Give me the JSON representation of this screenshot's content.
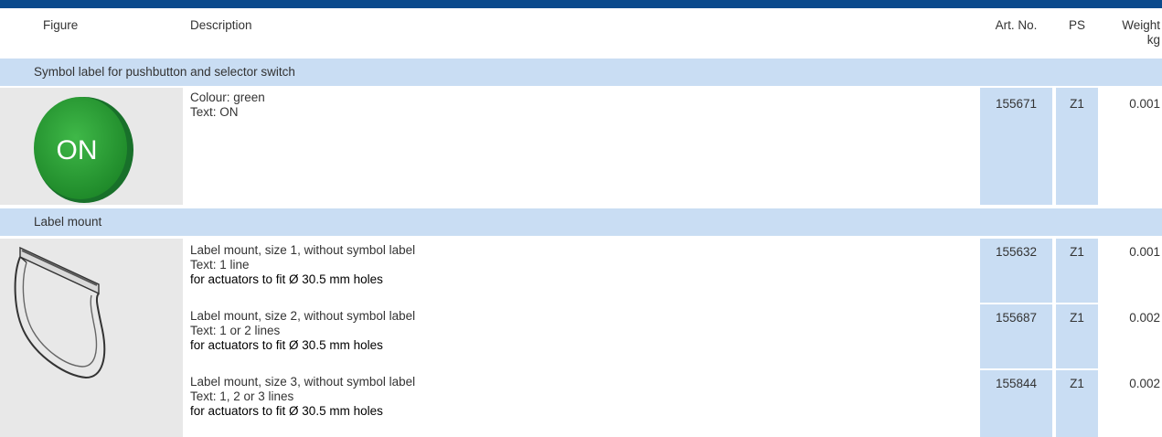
{
  "header": {
    "figure": "Figure",
    "description": "Description",
    "art_no": "Art. No.",
    "ps": "PS",
    "weight_line1": "Weight",
    "weight_line2": "kg"
  },
  "sections": [
    {
      "title": "Symbol label for pushbutton and selector switch",
      "figure_icon": "green-on-button-icon",
      "figure_text": "ON",
      "figure_color": "#2a9a33",
      "items": [
        {
          "line1": "Colour: green",
          "line2": "Text: ON",
          "line3": "",
          "art_no": "155671",
          "ps": "Z1",
          "weight": "0.001"
        }
      ]
    },
    {
      "title": "Label mount",
      "figure_icon": "label-mount-icon",
      "items": [
        {
          "line1": "Label mount, size 1, without symbol label",
          "line2": "Text: 1 line",
          "line3": "for actuators to fit Ø 30.5 mm holes",
          "art_no": "155632",
          "ps": "Z1",
          "weight": "0.001"
        },
        {
          "line1": "Label mount, size 2, without symbol label",
          "line2": "Text: 1 or 2 lines",
          "line3": "for actuators to fit Ø 30.5 mm holes",
          "art_no": "155687",
          "ps": "Z1",
          "weight": "0.002"
        },
        {
          "line1": "Label mount, size 3, without symbol label",
          "line2": "Text: 1, 2 or 3 lines",
          "line3": "for actuators to fit Ø 30.5 mm holes",
          "art_no": "155844",
          "ps": "Z1",
          "weight": "0.002"
        }
      ]
    }
  ],
  "colors": {
    "top_bar": "#0b4a8c",
    "section_background": "#c9ddf3",
    "figure_background": "#e8e8e8",
    "highlight_column": "#c9ddf3"
  }
}
